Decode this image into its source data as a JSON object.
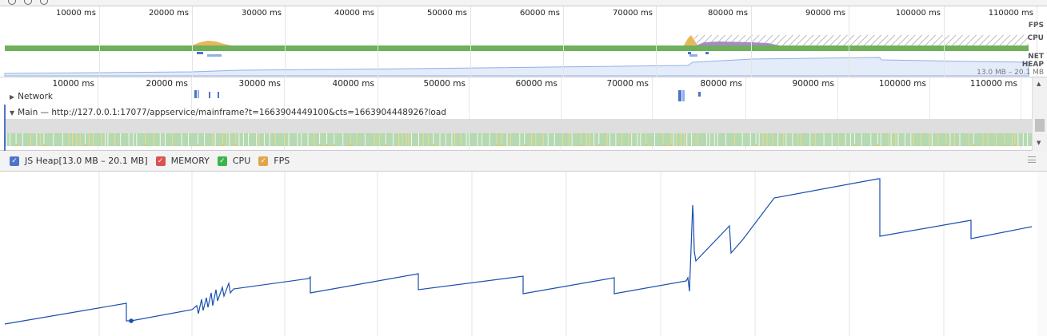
{
  "overview": {
    "ticks": [
      "10000 ms",
      "20000 ms",
      "30000 ms",
      "40000 ms",
      "50000 ms",
      "60000 ms",
      "70000 ms",
      "80000 ms",
      "90000 ms",
      "100000 ms",
      "110000 ms"
    ],
    "track_labels": {
      "fps": "FPS",
      "cpu": "CPU",
      "net": "NET",
      "heap": "HEAP",
      "heap_range": "13.0 MB – 20.1 MB"
    }
  },
  "flame": {
    "ticks": [
      "10000 ms",
      "20000 ms",
      "30000 ms",
      "40000 ms",
      "50000 ms",
      "60000 ms",
      "70000 ms",
      "80000 ms",
      "90000 ms",
      "100000 ms",
      "110000 ms"
    ],
    "network_label": "Network",
    "main_label": "Main — http://127.0.0.1:17077/appservice/mainframe?t=1663904449100&cts=1663904448926?load"
  },
  "legend": {
    "items": [
      {
        "label": "JS Heap[13.0 MB – 20.1 MB]",
        "color": "#4e74c9",
        "checked": true
      },
      {
        "label": "MEMORY",
        "color": "#d9534f",
        "checked": true
      },
      {
        "label": "CPU",
        "color": "#3bb54a",
        "checked": true
      },
      {
        "label": "FPS",
        "color": "#e0a64a",
        "checked": true
      }
    ]
  },
  "colors": {
    "heap_line": "#1a4fae",
    "cpu_green": "#6fb05a",
    "flame_green": "#b5d9b0",
    "accent": "#4e74c9"
  }
}
